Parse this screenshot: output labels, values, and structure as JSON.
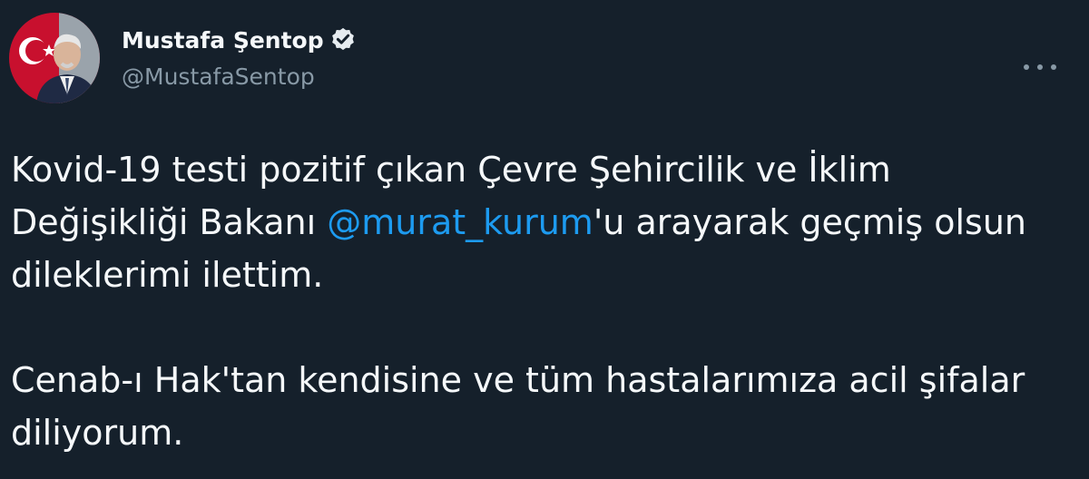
{
  "author": {
    "display_name": "Mustafa Şentop",
    "handle": "@MustafaSentop",
    "verified": true
  },
  "icons": {
    "verified": "verified-badge-icon",
    "more": "more-horizontal-icon"
  },
  "colors": {
    "background": "#15202b",
    "text": "#f5f8fa",
    "secondary": "#8899a6",
    "link": "#1d9bf0"
  },
  "tweet": {
    "paragraph1": {
      "before": "Kovid-19 testi pozitif çıkan Çevre Şehircilik ve İklim Değişikliği Bakanı ",
      "mention": "@murat_kurum",
      "after": "'u arayarak geçmiş olsun dileklerimi ilettim."
    },
    "paragraph2": "Cenab-ı Hak'tan kendisine ve tüm hastalarımıza acil şifalar diliyorum."
  }
}
